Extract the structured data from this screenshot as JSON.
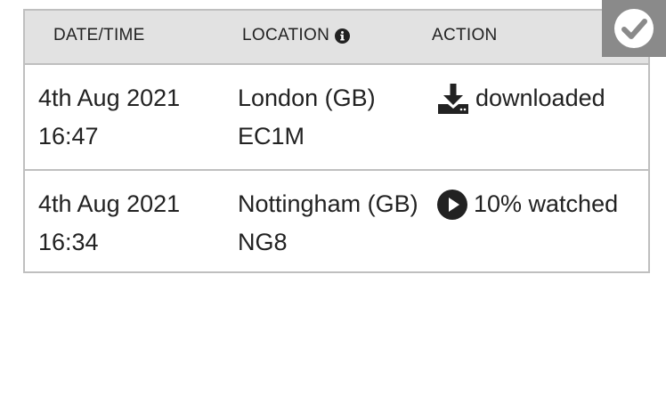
{
  "table": {
    "headers": {
      "datetime": "DATE/TIME",
      "location": "LOCATION",
      "action": "ACTION"
    },
    "rows": [
      {
        "date": "4th Aug 2021",
        "time": "16:47",
        "location_line1": "London (GB)",
        "location_line2": "EC1M",
        "action_icon": "download-icon",
        "action_label": "downloaded"
      },
      {
        "date": "4th Aug 2021",
        "time": "16:34",
        "location_line1": "Nottingham (GB)",
        "location_line2": "NG8",
        "action_icon": "play-circle-icon",
        "action_label": "10% watched"
      }
    ]
  },
  "badge": {
    "icon": "checkmark-circle-icon",
    "color": "#8a8a8a"
  },
  "colors": {
    "header_bg": "#e2e2e2",
    "border": "#bfbfbf",
    "text": "#222222"
  }
}
